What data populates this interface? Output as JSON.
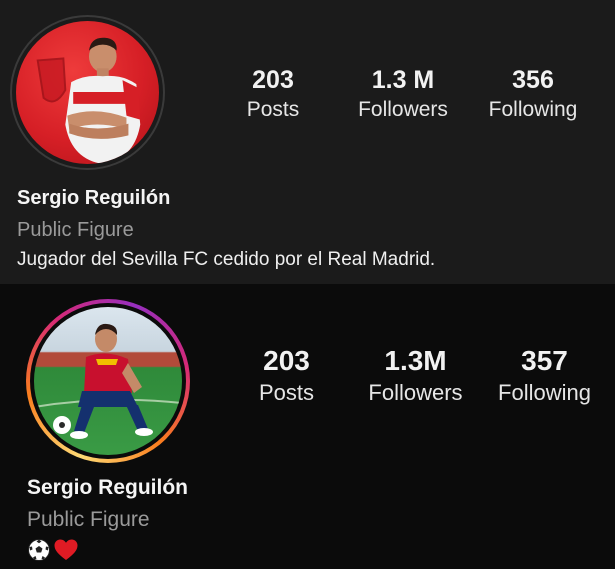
{
  "profiles": [
    {
      "stats": [
        {
          "value": "203",
          "label": "Posts"
        },
        {
          "value": "1.3 M",
          "label": "Followers"
        },
        {
          "value": "356",
          "label": "Following"
        }
      ],
      "name": "Sergio Reguilón",
      "category": "Public Figure",
      "bio": "Jugador del Sevilla FC cedido por el Real Madrid."
    },
    {
      "stats": [
        {
          "value": "203",
          "label": "Posts"
        },
        {
          "value": "1.3M",
          "label": "Followers"
        },
        {
          "value": "357",
          "label": "Following"
        }
      ],
      "name": "Sergio Reguilón",
      "category": "Public Figure",
      "bio_icons": [
        "soccer-ball-icon",
        "red-heart-icon"
      ]
    }
  ],
  "colors": {
    "top_background": "#1b1b1b",
    "bottom_background": "#0b0b0b",
    "sevilla_red": "#d61f26",
    "category_gray": "#9a9a9a",
    "heart_red": "#e01b24"
  }
}
